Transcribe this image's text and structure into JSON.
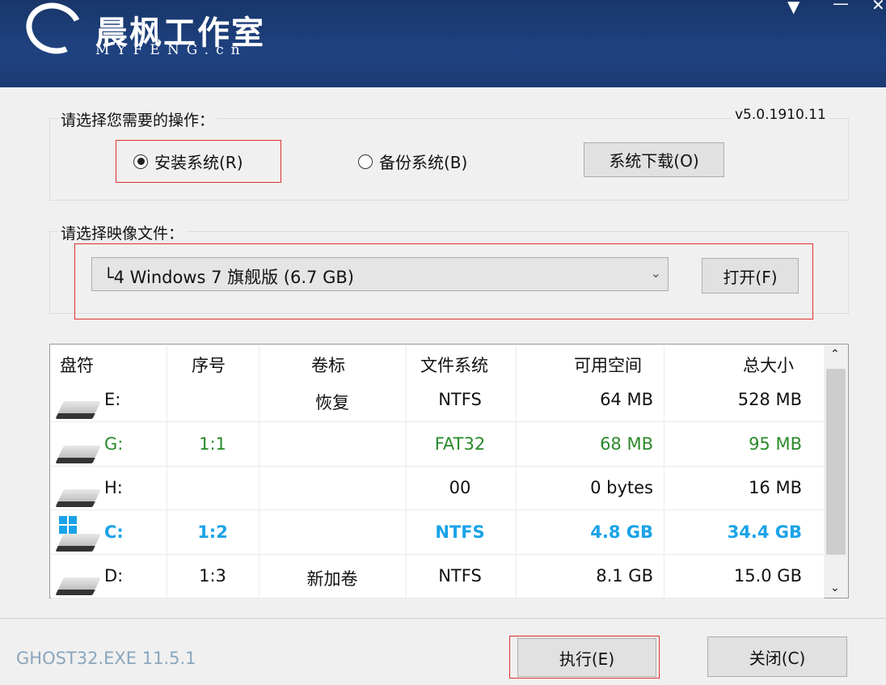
{
  "header": {
    "brand": "晨枫工作室",
    "brand_sub": "MYFENG.cn",
    "menu_icon": "dropdown-arrow-icon",
    "minimize_icon": "minimize-icon",
    "close_icon": "close-icon"
  },
  "operation": {
    "label": "请选择您需要的操作：",
    "version": "v5.0.1910.11",
    "install": "安装系统(R)",
    "backup": "备份系统(B)",
    "download": "系统下载(O)",
    "selected": "install"
  },
  "image": {
    "label": "请选择映像文件：",
    "value": "└4 Windows 7 旗舰版 (6.7 GB)",
    "open": "打开(F)"
  },
  "table": {
    "headers": [
      "盘符",
      "序号",
      "卷标",
      "文件系统",
      "可用空间",
      "总大小"
    ],
    "rows": [
      {
        "drive": "E:",
        "index": "",
        "label": "恢复",
        "fs": "NTFS",
        "free": "64 MB",
        "total": "528 MB",
        "style": "normal"
      },
      {
        "drive": "G:",
        "index": "1:1",
        "label": "",
        "fs": "FAT32",
        "free": "68 MB",
        "total": "95 MB",
        "style": "green"
      },
      {
        "drive": "H:",
        "index": "",
        "label": "",
        "fs": "00",
        "free": "0 bytes",
        "total": "16 MB",
        "style": "normal"
      },
      {
        "drive": "C:",
        "index": "1:2",
        "label": "",
        "fs": "NTFS",
        "free": "4.8 GB",
        "total": "34.4 GB",
        "style": "blue"
      },
      {
        "drive": "D:",
        "index": "1:3",
        "label": "新加卷",
        "fs": "NTFS",
        "free": "8.1 GB",
        "total": "15.0 GB",
        "style": "normal"
      }
    ]
  },
  "footer": {
    "ghost": "GHOST32.EXE 11.5.1",
    "execute": "执行(E)",
    "close": "关闭(C)"
  },
  "colors": {
    "green": "#2a8a2a",
    "blue": "#1aa3e8",
    "highlight": "#e0302f"
  }
}
